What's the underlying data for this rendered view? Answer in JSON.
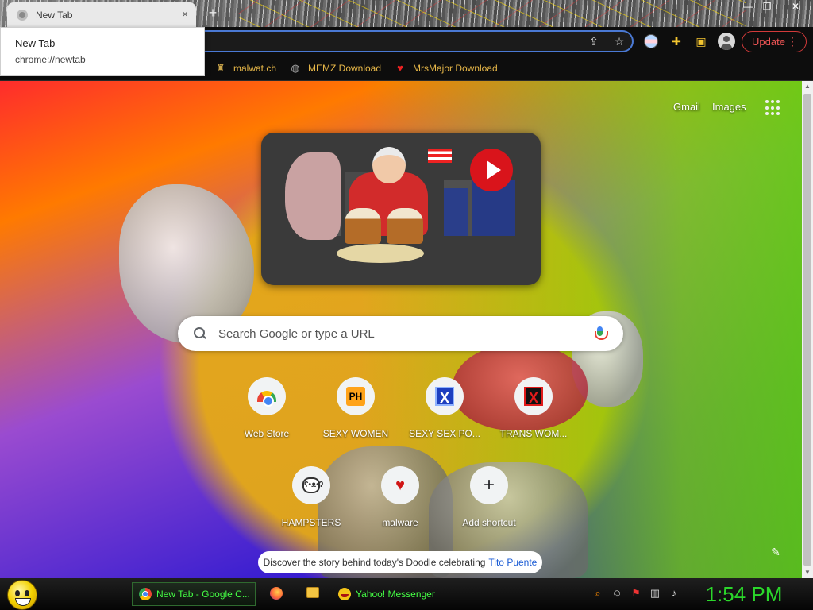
{
  "browser": {
    "tab": {
      "title": "New Tab",
      "close_glyph": "×"
    },
    "new_tab_glyph": "+",
    "hovercard": {
      "title": "New Tab",
      "url": "chrome://newtab"
    },
    "toolbar": {
      "update_label": "Update",
      "menu_glyph": "⋮"
    },
    "bookmarks": [
      {
        "label": "malwat.ch",
        "icon": "tower-icon",
        "glyph": "♜"
      },
      {
        "label": "MEMZ Download",
        "icon": "globe-icon",
        "glyph": "◍"
      },
      {
        "label": "MrsMajor Download",
        "icon": "heart-icon",
        "glyph": "♥"
      }
    ]
  },
  "ntp": {
    "top_links": {
      "gmail": "Gmail",
      "images": "Images"
    },
    "search": {
      "placeholder": "Search Google or type a URL"
    },
    "shortcuts": [
      {
        "label": "Web Store",
        "icon": "chrome-web-store-icon",
        "glyph": ""
      },
      {
        "label": "SEXY WOMEN",
        "icon": "ph-icon",
        "glyph": "PH"
      },
      {
        "label": "SEXY SEX PO...",
        "icon": "x-blue-icon",
        "glyph": "X"
      },
      {
        "label": "TRANS WOM...",
        "icon": "x-red-icon",
        "glyph": "X"
      },
      {
        "label": "HAMPSTERS",
        "icon": "hamster-icon",
        "glyph": "ʕ•ᴥ•ʔ"
      },
      {
        "label": "malware",
        "icon": "heart-icon",
        "glyph": "♥"
      },
      {
        "label": "Add shortcut",
        "icon": "plus-icon",
        "glyph": "+"
      }
    ],
    "doodle_share": {
      "text": "Discover the story behind today's Doodle celebrating",
      "link": "Tito Puente"
    }
  },
  "taskbar": {
    "tasks": [
      {
        "label": "New Tab - Google C...",
        "icon": "chrome-icon"
      },
      {
        "label": "Yahoo! Messenger",
        "icon": "yahoo-messenger-icon"
      }
    ],
    "clock": "1:54 PM"
  },
  "colors": {
    "bookmark_text": "#e9b949",
    "update_accent": "#f05555",
    "taskbar_text": "#45ff45",
    "clock": "#2bd72b"
  }
}
